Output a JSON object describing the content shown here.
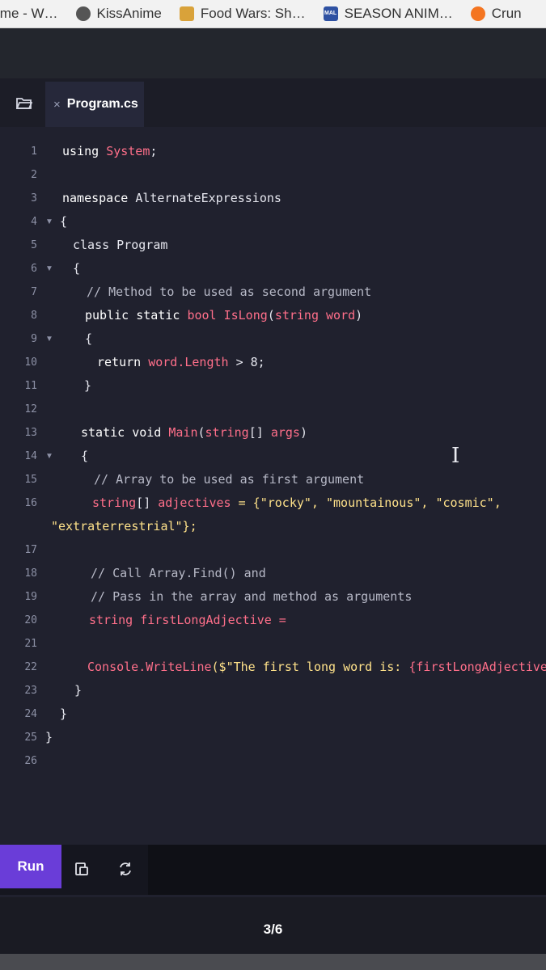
{
  "bookmarks": [
    {
      "label": "ime - W…",
      "icon": "none"
    },
    {
      "label": "KissAnime",
      "icon": "globe-icon"
    },
    {
      "label": "Food Wars: Sh…",
      "icon": "food-wars-icon"
    },
    {
      "label": "SEASON ANIM…",
      "icon": "mal-icon",
      "icon_text": "MAL"
    },
    {
      "label": "Crun",
      "icon": "crunchyroll-icon"
    }
  ],
  "editor": {
    "tab_name": "Program.cs",
    "tab_close": "×",
    "folder_icon": "folder-open-icon"
  },
  "line_numbers": [
    "1",
    "2",
    "3",
    "4",
    "5",
    "6",
    "7",
    "8",
    "9",
    "10",
    "11",
    "12",
    "13",
    "14",
    "15",
    "16",
    "17",
    "18",
    "19",
    "20",
    "21",
    "22",
    "23",
    "24",
    "25",
    "26"
  ],
  "code": {
    "l1_kw": "using ",
    "l1_ty": "System",
    "l1_end": ";",
    "l3_kw": "namespace ",
    "l3_name": "AlternateExpressions",
    "l4": "{",
    "l5": "class Program",
    "l6": "{",
    "l7": "// Method to be used as second argument",
    "l8_kw": "public static ",
    "l8_ty": "bool IsLong",
    "l8_p": "(",
    "l8_ty2": "string word",
    "l8_end": ")",
    "l9": "{",
    "l10_kw": "return ",
    "l10_ty": "word.Length",
    "l10_end": " > 8;",
    "l11": "}",
    "l13_kw": "static void ",
    "l13_ty": "Main",
    "l13_p": "(",
    "l13_ty2": "string",
    "l13_mid": "[] ",
    "l13_ty3": "args",
    "l13_end": ")",
    "l14": "{",
    "l15": "// Array to be used as first argument",
    "l16_ty": "string",
    "l16_mid": "[] ",
    "l16_ty2": "adjectives",
    "l16_end": " = {\"rocky\", \"mountainous\", \"cosmic\",",
    "l16b": "\"extraterrestrial\"};",
    "l18": "// Call Array.Find() and",
    "l19": "// Pass in the array and method as arguments",
    "l20_ty": "string firstLongAdjective",
    "l20_end": " =",
    "l22_ty": "Console.WriteLine",
    "l22_st": "($\"The first long word is: ",
    "l22_var": "{firstLongAdjective}",
    "l22_end": ".\"",
    "l23": "}",
    "l24": "}",
    "l25": "}"
  },
  "toolbar": {
    "run_label": "Run",
    "copy_icon": "copy-clipboard-icon",
    "reset_icon": "reset-icon"
  },
  "pagination": "3/6"
}
